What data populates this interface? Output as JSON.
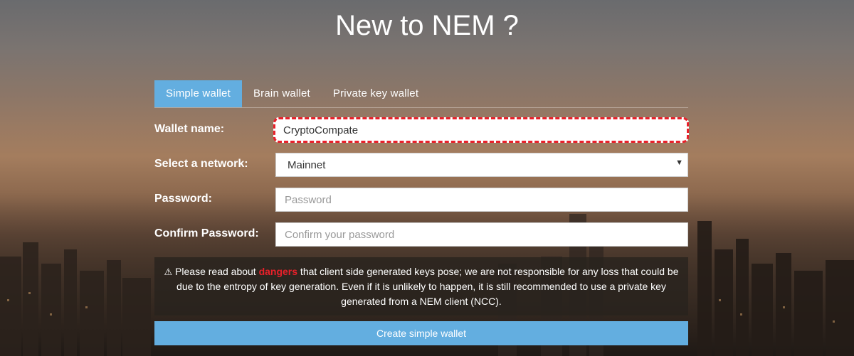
{
  "page": {
    "title": "New to NEM ?"
  },
  "tabs": [
    {
      "label": "Simple wallet",
      "active": true
    },
    {
      "label": "Brain wallet",
      "active": false
    },
    {
      "label": "Private key wallet",
      "active": false
    }
  ],
  "form": {
    "wallet_name": {
      "label": "Wallet name:",
      "value": "CryptoCompate"
    },
    "network": {
      "label": "Select a network:",
      "value": "Mainnet"
    },
    "password": {
      "label": "Password:",
      "placeholder": "Password"
    },
    "confirm_password": {
      "label": "Confirm Password:",
      "placeholder": "Confirm your password"
    }
  },
  "notice": {
    "icon": "warning-icon",
    "text_before": "Please read about ",
    "danger_link": "dangers",
    "text_after": " that client side generated keys pose; we are not responsible for any loss that could be due to the entropy of key generation. Even if it is unlikely to happen, it is still recommended to use a private key generated from a NEM client (NCC).",
    "danger_color": "#e8202a"
  },
  "actions": {
    "create_label": "Create simple wallet"
  },
  "colors": {
    "accent": "#63aee0",
    "highlight_border": "#e8202a"
  }
}
